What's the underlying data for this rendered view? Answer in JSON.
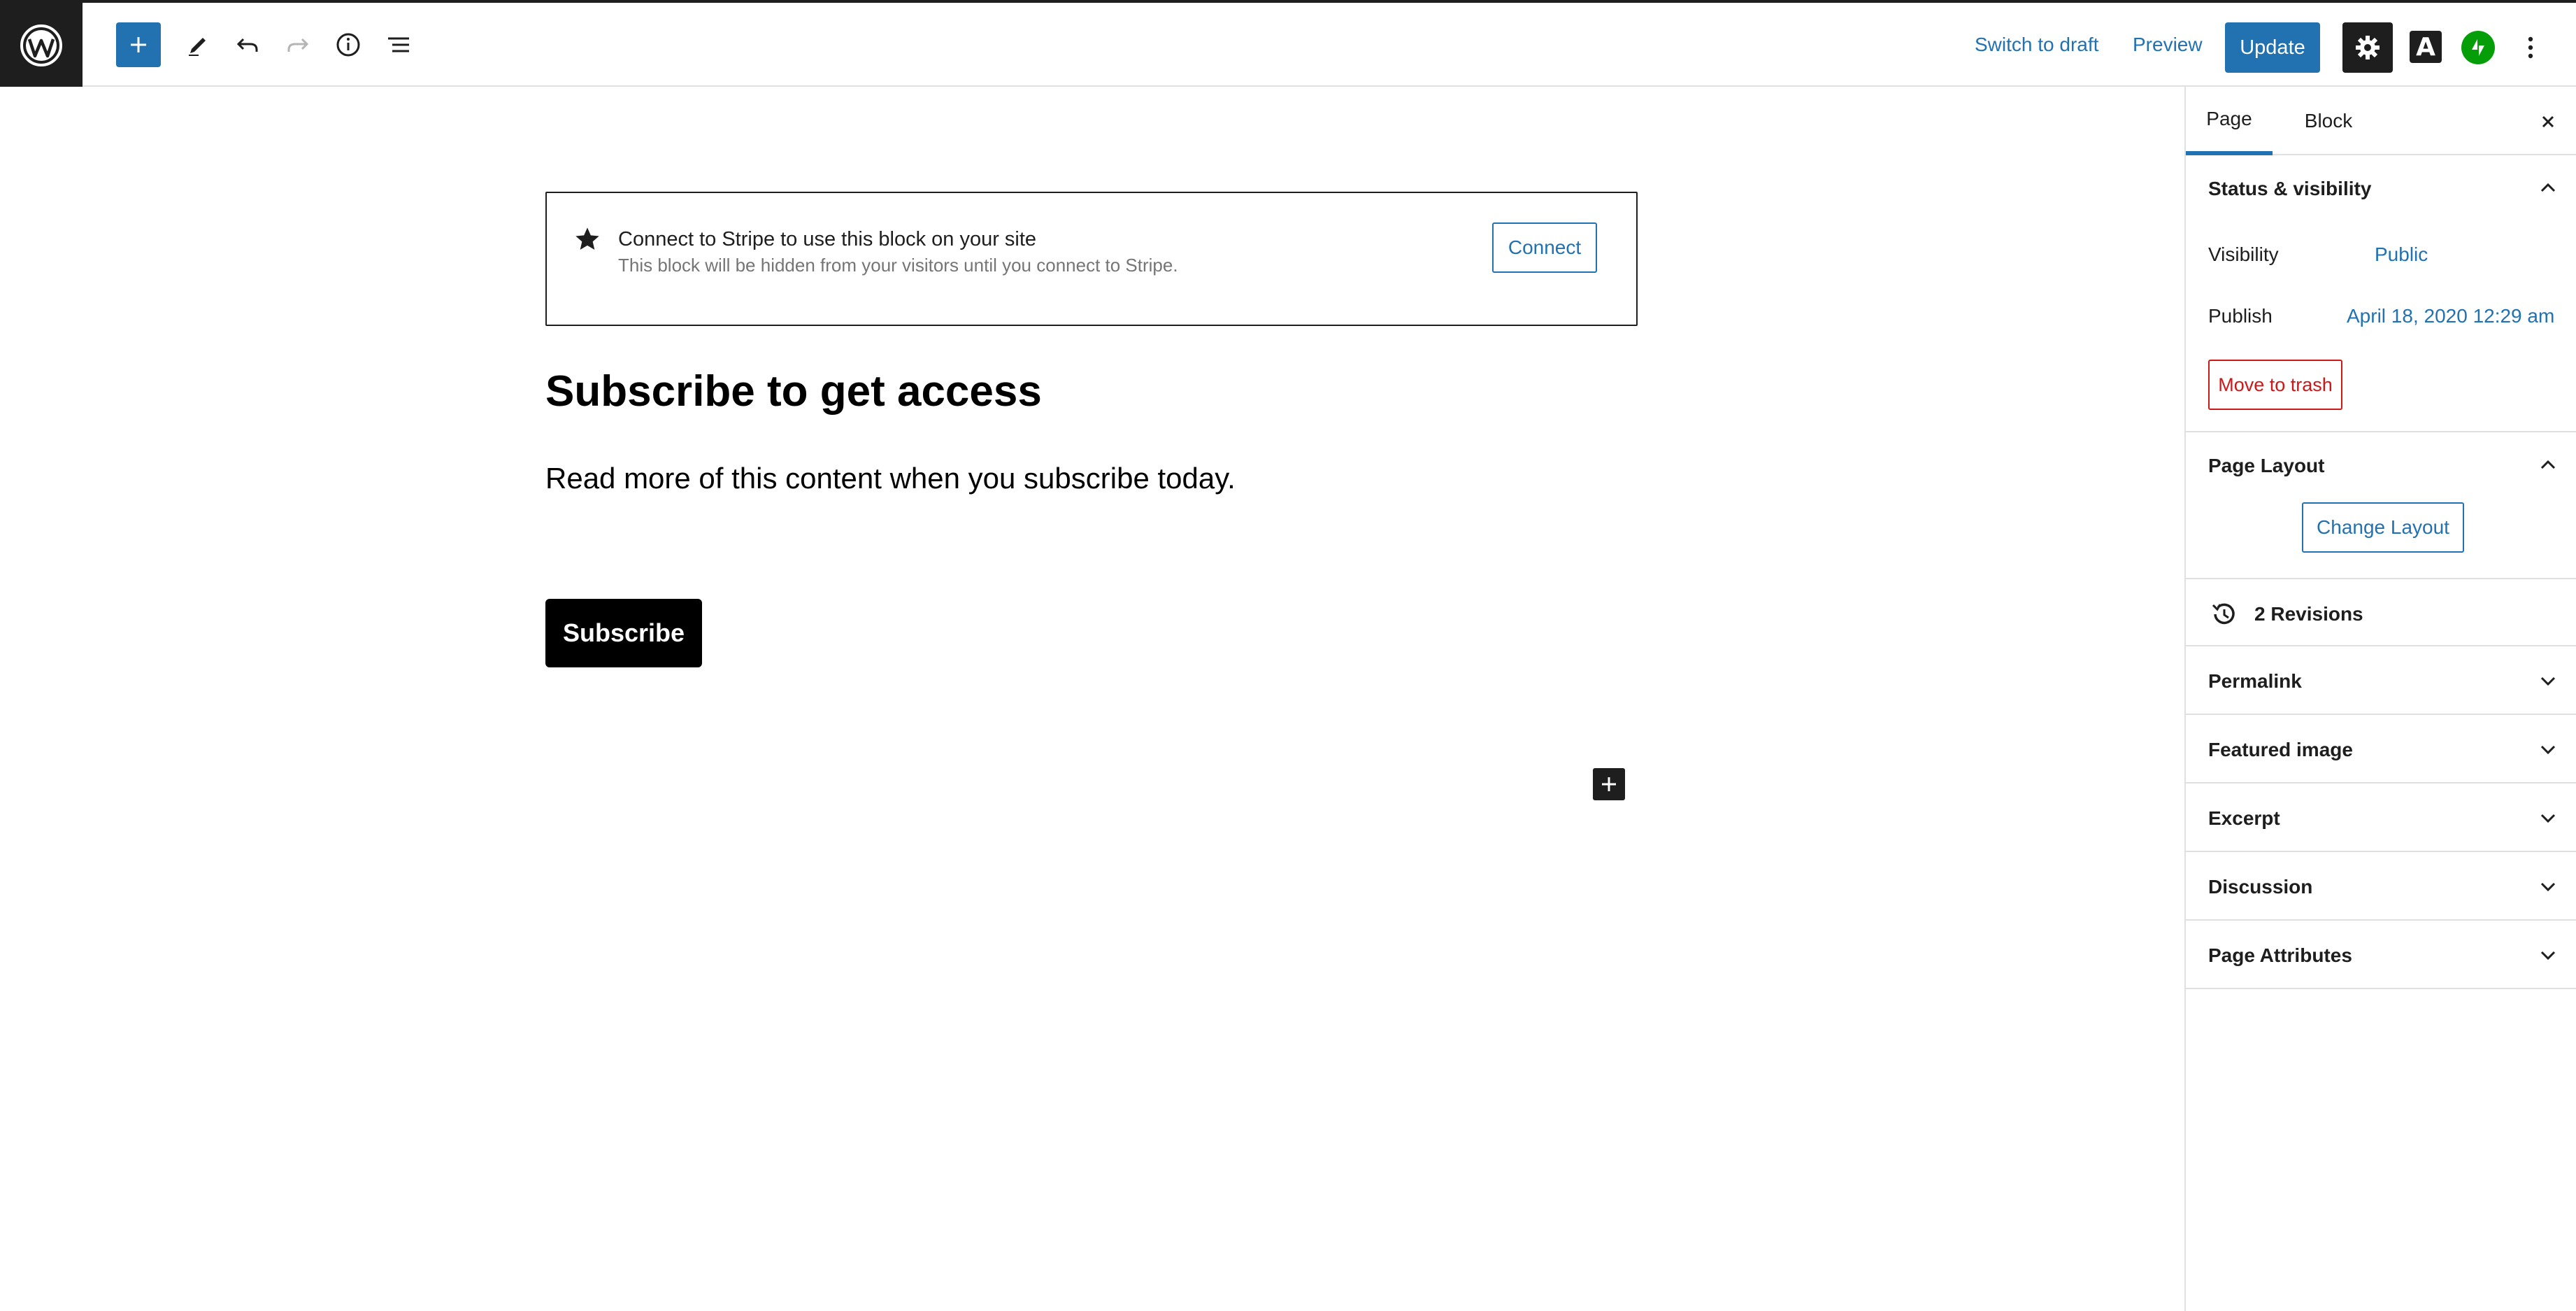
{
  "toolbar": {
    "switch_to_draft": "Switch to draft",
    "preview": "Preview",
    "update": "Update",
    "font_button": "A",
    "accent_color": "#2271b1"
  },
  "icons": {
    "logo": "wordpress-logo-icon",
    "add": "plus-icon",
    "tools": "pencil-icon",
    "undo": "undo-icon",
    "redo": "redo-icon",
    "details": "info-icon",
    "list_view": "list-view-icon",
    "settings": "gear-icon",
    "jetpack": "jetpack-icon",
    "more": "more-vertical-icon",
    "close": "close-icon",
    "star": "star-icon",
    "revisions": "history-icon",
    "chevron_up": "chevron-up-icon",
    "chevron_down": "chevron-down-icon"
  },
  "editor": {
    "stripe_notice": {
      "title": "Connect to Stripe to use this block on your site",
      "subtitle": "This block will be hidden from your visitors until you connect to Stripe.",
      "button": "Connect"
    },
    "heading": "Subscribe to get access",
    "paragraph": "Read more of this content when you subscribe today.",
    "subscribe_button": "Subscribe"
  },
  "sidebar": {
    "tabs": [
      "Page",
      "Block"
    ],
    "status_visibility": {
      "title": "Status & visibility",
      "visibility_label": "Visibility",
      "visibility_value": "Public",
      "publish_label": "Publish",
      "publish_value": "April 18, 2020 12:29 am",
      "trash_button": "Move to trash"
    },
    "page_layout": {
      "title": "Page Layout",
      "button": "Change Layout"
    },
    "revisions": "2 Revisions",
    "panels": [
      "Permalink",
      "Featured image",
      "Excerpt",
      "Discussion",
      "Page Attributes"
    ]
  }
}
